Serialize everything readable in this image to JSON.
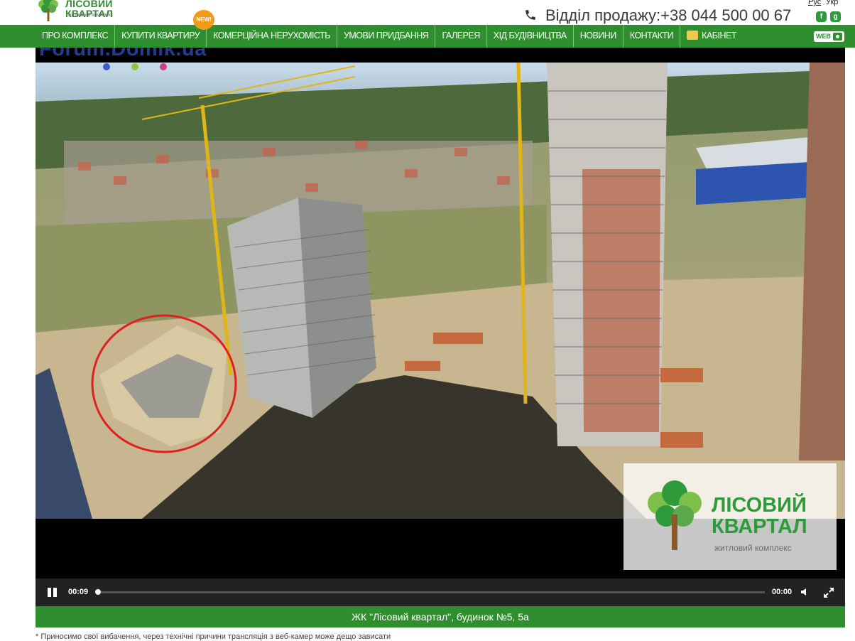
{
  "header": {
    "logo": {
      "name_line1": "ЛІСОВИЙ",
      "name_line2": "КВАРТАЛ",
      "tagline": "житловий комплекс"
    },
    "lang": {
      "ru": "Рус",
      "uk": "Укр"
    },
    "phone": "Відділ продажу:+38 044 500 00 67",
    "social": {
      "fb": "f",
      "gplus": "g"
    }
  },
  "nav": {
    "items": [
      {
        "label": "ПРО КОМПЛЕКС"
      },
      {
        "label": "КУПИТИ КВАРТИРУ"
      },
      {
        "label": "КОМЕРЦІЙНА НЕРУХОМІСТЬ"
      },
      {
        "label": "УМОВИ ПРИДБАННЯ"
      },
      {
        "label": "ГАЛЕРЕЯ"
      },
      {
        "label": "ХІД БУДІВНИЦТВА"
      },
      {
        "label": "НОВИНИ"
      },
      {
        "label": "КОНТАКТИ"
      },
      {
        "label": "КАБІНЕТ"
      }
    ],
    "new_badge": "NEW!",
    "web_button": "WEB"
  },
  "video": {
    "watermark": "Forum.Domik.ua",
    "overlay_logo": {
      "line1": "ЛІСОВИЙ",
      "line2": "КВАРТАЛ",
      "tagline": "житловий комплекс"
    },
    "controls": {
      "current_time": "00:09",
      "end_time": "00:00",
      "progress": 0.0
    }
  },
  "caption": "ЖК \"Лісовий квартал\", будинок №5, 5а",
  "footnote": "* Приносимо свої вибачення, через технічні причини трансляція з веб-камер може дещо зависати"
}
